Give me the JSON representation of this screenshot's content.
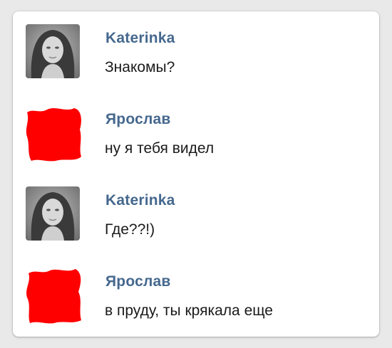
{
  "colors": {
    "name": "#45688e",
    "text": "#1a1a1a",
    "redaction": "#ff0000",
    "background": "#e9e9e9",
    "card": "#ffffff"
  },
  "messages": [
    {
      "author": "Katerinka",
      "text": "Знакомы?",
      "avatar": "user-photo"
    },
    {
      "author": "Ярослав",
      "text": "ну я тебя видел",
      "avatar": "redacted"
    },
    {
      "author": "Katerinka",
      "text": "Где??!)",
      "avatar": "user-photo"
    },
    {
      "author": "Ярослав",
      "text": "в пруду, ты крякала еще",
      "avatar": "redacted"
    }
  ]
}
